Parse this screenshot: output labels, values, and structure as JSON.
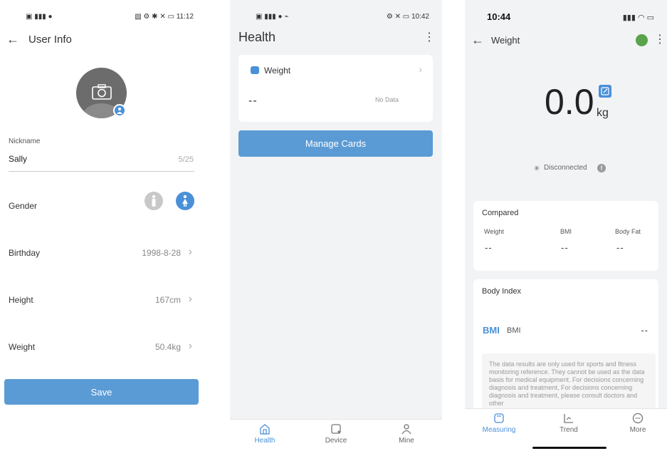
{
  "screen1": {
    "status_time": "11:12",
    "status_battery": "70",
    "title": "User Info",
    "nickname_label": "Nickname",
    "nickname_value": "Sally",
    "nickname_count": "5/25",
    "rows": [
      {
        "label": "Gender"
      },
      {
        "label": "Birthday",
        "value": "1998-8-28"
      },
      {
        "label": "Height",
        "value": "167cm"
      },
      {
        "label": "Weight",
        "value": "50.4kg"
      }
    ],
    "gender_selected": "female",
    "save_label": "Save",
    "accent": "#5b9bd5"
  },
  "screen2": {
    "status_time": "10:42",
    "status_battery": "92",
    "title": "Health",
    "card_title": "Weight",
    "card_value": "--",
    "card_nodata": "No Data",
    "manage_label": "Manage Cards",
    "tabs": [
      {
        "label": "Health",
        "icon": "house-icon",
        "active": true
      },
      {
        "label": "Device",
        "icon": "device-icon",
        "active": false
      },
      {
        "label": "Mine",
        "icon": "person-icon",
        "active": false
      }
    ]
  },
  "screen3": {
    "status_time": "10:44",
    "title": "Weight",
    "weight_value": "0.0",
    "weight_unit": "kg",
    "connection_status": "Disconnected",
    "compared_title": "Compared",
    "compared_cols": [
      {
        "label": "Weight",
        "value": "--"
      },
      {
        "label": "BMI",
        "value": "--"
      },
      {
        "label": "Body Fat",
        "value": "--"
      }
    ],
    "body_index_title": "Body Index",
    "bmi_badge": "BMI",
    "bmi_label": "BMI",
    "bmi_value": "--",
    "disclaimer": "The data results are only used for sports and fitness monitoring reference. They cannot be used as the data basis for medical equipment. For decisions concerning diagnosis and treatment, For decisions concerning diagnosis and treatment, please consult doctors and other",
    "tabs": [
      {
        "label": "Measuring",
        "icon": "scale-icon",
        "active": true
      },
      {
        "label": "Trend",
        "icon": "trend-icon",
        "active": false
      },
      {
        "label": "More",
        "icon": "more-icon",
        "active": false
      }
    ]
  }
}
